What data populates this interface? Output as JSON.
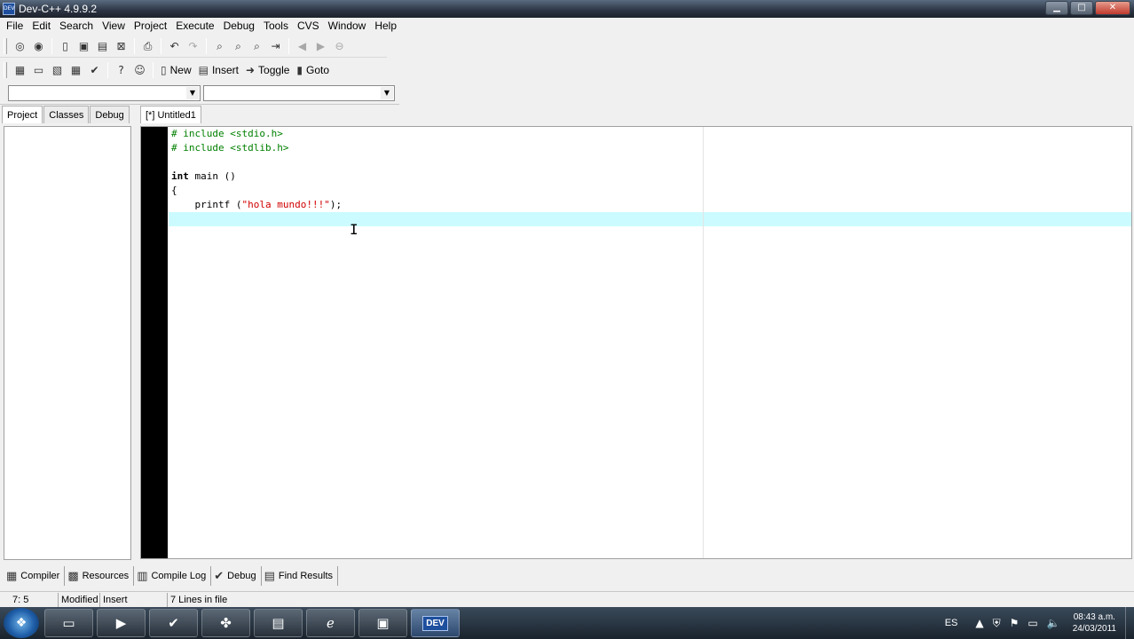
{
  "window": {
    "title": "Dev-C++ 4.9.9.2",
    "app_icon": "DEV",
    "controls": {
      "minimize": "▁",
      "maximize": "□",
      "close": "✕"
    }
  },
  "menu": [
    "File",
    "Edit",
    "Search",
    "View",
    "Project",
    "Execute",
    "Debug",
    "Tools",
    "CVS",
    "Window",
    "Help"
  ],
  "toolbar2": {
    "new_label": "New",
    "insert_label": "Insert",
    "toggle_label": "Toggle",
    "goto_label": "Goto"
  },
  "combos": {
    "class_value": "",
    "function_value": ""
  },
  "left_tabs": [
    "Project",
    "Classes",
    "Debug"
  ],
  "editor": {
    "tab_title": "[*] Untitled1",
    "line1_pp": "# include <stdio.h>",
    "line2_pp": "# include <stdlib.h>",
    "line4_kw": "int",
    "line4_rest": " main ()",
    "line5": "{",
    "line6_func": "    printf (",
    "line6_str": "\"hola mundo!!!\"",
    "line6_end": ");"
  },
  "bottom_tabs": [
    "Compiler",
    "Resources",
    "Compile Log",
    "Debug",
    "Find Results"
  ],
  "status": {
    "position": "7: 5",
    "modified": "Modified",
    "mode": "Insert",
    "lines": "7 Lines in file"
  },
  "taskbar": {
    "lang": "ES",
    "time": "08:43 a.m.",
    "date": "24/03/2011",
    "active_app_label": "DEV"
  },
  "colors": {
    "current_line": "#ccfbff",
    "preprocessor": "#008000",
    "string": "#d10000",
    "gutter": "#000000"
  }
}
